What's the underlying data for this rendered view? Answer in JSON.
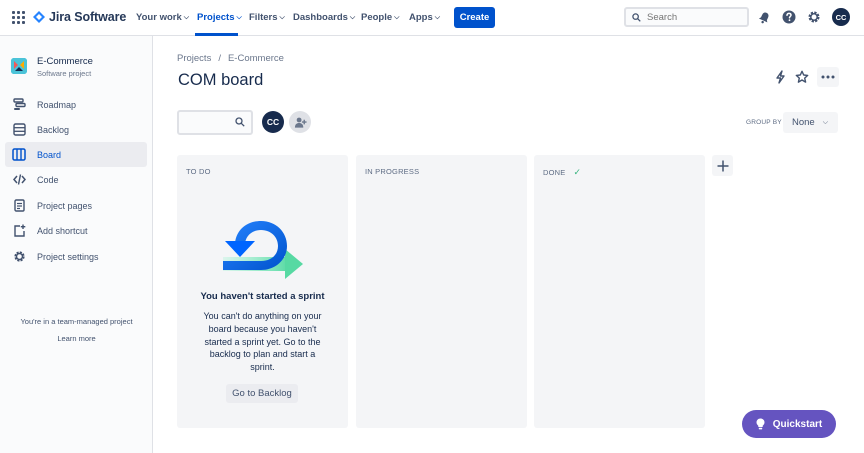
{
  "topnav": {
    "product_name": "Jira Software",
    "items": [
      {
        "label": "Your work"
      },
      {
        "label": "Projects",
        "active": true
      },
      {
        "label": "Filters"
      },
      {
        "label": "Dashboards"
      },
      {
        "label": "People"
      },
      {
        "label": "Apps"
      }
    ],
    "create_label": "Create",
    "search_placeholder": "Search",
    "user_initials": "CC"
  },
  "sidebar": {
    "project_name": "E-Commerce",
    "project_type": "Software project",
    "items": [
      {
        "label": "Roadmap",
        "icon": "roadmap-icon"
      },
      {
        "label": "Backlog",
        "icon": "backlog-icon"
      },
      {
        "label": "Board",
        "icon": "board-icon",
        "active": true
      },
      {
        "label": "Code",
        "icon": "code-icon"
      },
      {
        "label": "Project pages",
        "icon": "page-icon"
      },
      {
        "label": "Add shortcut",
        "icon": "add-shortcut-icon"
      },
      {
        "label": "Project settings",
        "icon": "gear-icon"
      }
    ],
    "footer_text": "You're in a team-managed project",
    "learn_more": "Learn more"
  },
  "main": {
    "breadcrumb": [
      "Projects",
      "E-Commerce"
    ],
    "title": "COM board",
    "avatar_initials": "CC",
    "groupby_label": "GROUP BY",
    "groupby_value": "None",
    "columns": [
      {
        "title": "TO DO"
      },
      {
        "title": "IN PROGRESS"
      },
      {
        "title": "DONE"
      }
    ],
    "empty_state": {
      "title": "You haven't started a sprint",
      "text": "You can't do anything on your board because you haven't started a sprint yet. Go to the backlog to plan and start a sprint.",
      "button": "Go to Backlog"
    },
    "quickstart_label": "Quickstart"
  },
  "colors": {
    "brand_blue": "#0052cc",
    "quickstart_purple": "#6554c0",
    "done_green": "#36b37e"
  }
}
